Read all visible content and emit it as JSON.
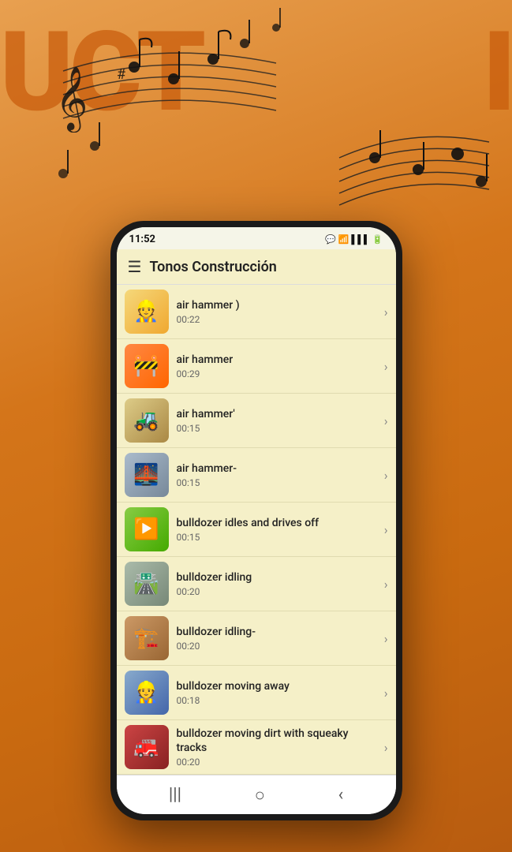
{
  "background": {
    "text_left": "UCT",
    "text_right": "I"
  },
  "status_bar": {
    "time": "11:52",
    "icons": "📶 📶 🔋"
  },
  "header": {
    "title": "Tonos Construcción",
    "menu_icon": "☰"
  },
  "nav": {
    "back_icon": "‹",
    "home_icon": "○",
    "recent_icon": "|||"
  },
  "list_items": [
    {
      "id": 1,
      "title": "air hammer )",
      "duration": "00:22",
      "emoji": "👷",
      "thumb_class": "thumb-1"
    },
    {
      "id": 2,
      "title": "air hammer",
      "duration": "00:29",
      "emoji": "🚧",
      "thumb_class": "thumb-2"
    },
    {
      "id": 3,
      "title": "air hammer'",
      "duration": "00:15",
      "emoji": "🚜",
      "thumb_class": "thumb-3"
    },
    {
      "id": 4,
      "title": "air hammer-",
      "duration": "00:15",
      "emoji": "🌉",
      "thumb_class": "thumb-4"
    },
    {
      "id": 5,
      "title": "bulldozer idles and drives off",
      "duration": "00:15",
      "emoji": "▶️",
      "thumb_class": "thumb-5"
    },
    {
      "id": 6,
      "title": "bulldozer idling",
      "duration": "00:20",
      "emoji": "🛣️",
      "thumb_class": "thumb-6"
    },
    {
      "id": 7,
      "title": "bulldozer idling-",
      "duration": "00:20",
      "emoji": "🏗️",
      "thumb_class": "thumb-7"
    },
    {
      "id": 8,
      "title": "bulldozer moving away",
      "duration": "00:18",
      "emoji": "👷",
      "thumb_class": "thumb-8"
    },
    {
      "id": 9,
      "title": "bulldozer moving dirt with squeaky tracks",
      "duration": "00:20",
      "emoji": "🚒",
      "thumb_class": "thumb-9"
    }
  ]
}
